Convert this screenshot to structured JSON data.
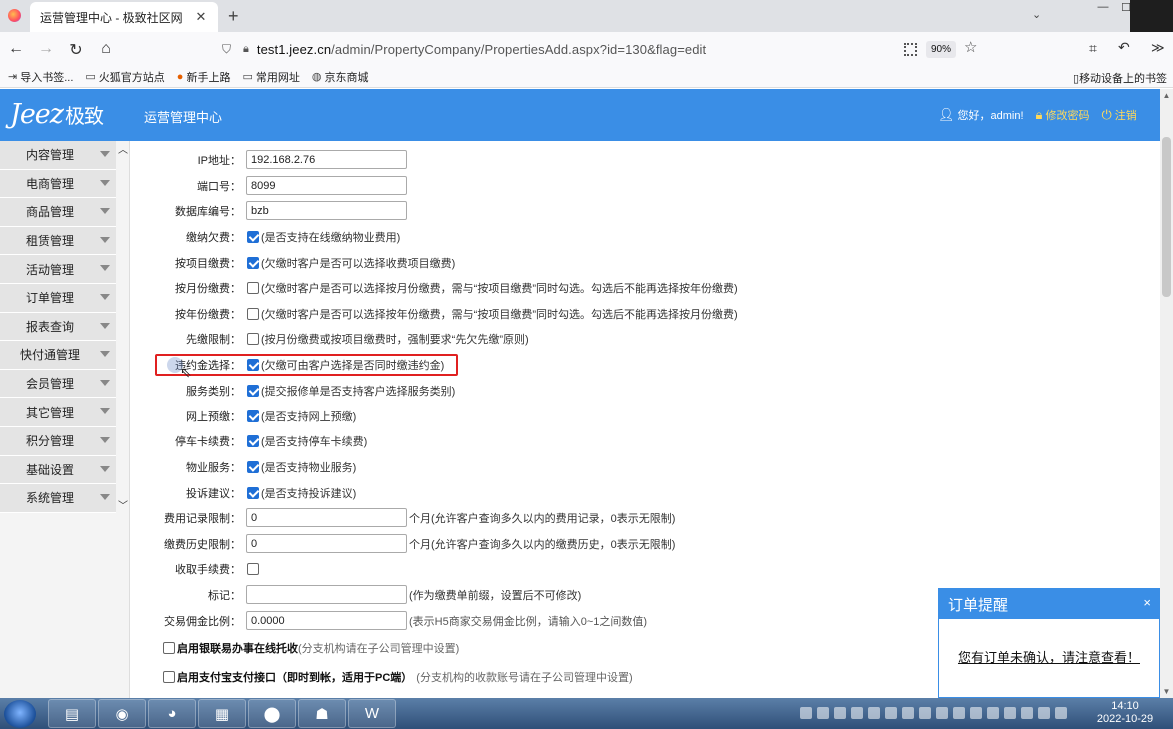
{
  "browser": {
    "tab_title": "运营管理中心 - 极致社区网",
    "url_host": "test1.jeez.cn",
    "url_path": "/admin/PropertyCompany/PropertiesAdd.aspx?id=130&flag=edit",
    "zoom": "90%",
    "bookmarks": [
      "导入书签...",
      "火狐官方站点",
      "新手上路",
      "常用网址",
      "京东商城"
    ],
    "mobile_bookmarks": "移动设备上的书签"
  },
  "header": {
    "logo_latin": "Jeez",
    "logo_cn": "极致",
    "title": "运营管理中心",
    "greeting": "您好，admin!",
    "change_password": "修改密码",
    "logout": "注销"
  },
  "sidebar": {
    "items": [
      "内容管理",
      "电商管理",
      "商品管理",
      "租赁管理",
      "活动管理",
      "订单管理",
      "报表查询",
      "快付通管理",
      "会员管理",
      "其它管理",
      "积分管理",
      "基础设置",
      "系统管理"
    ]
  },
  "form": {
    "ip_label": "IP地址：",
    "ip_value": "192.168.2.76",
    "port_label": "端口号：",
    "port_value": "8099",
    "db_label": "数据库编号：",
    "db_value": "bzb",
    "pay_arrears_label": "缴纳欠费：",
    "pay_arrears_desc": "(是否支持在线缴纳物业费用)",
    "by_item_label": "按项目缴费：",
    "by_item_desc": "(欠缴时客户是否可以选择收费项目缴费)",
    "by_month_label": "按月份缴费：",
    "by_month_desc": "(欠缴时客户是否可以选择按月份缴费，需与“按项目缴费”同时勾选。勾选后不能再选择按年份缴费)",
    "by_year_label": "按年份缴费：",
    "by_year_desc": "(欠缴时客户是否可以选择按年份缴费，需与“按项目缴费”同时勾选。勾选后不能再选择按月份缴费)",
    "first_owe_label": "先缴限制：",
    "first_owe_desc": "(按月份缴费或按项目缴费时，强制要求“先欠先缴”原则)",
    "penalty_label": "违约金选择：",
    "penalty_desc": "(欠缴可由客户选择是否同时缴违约金)",
    "service_type_label": "服务类别：",
    "service_type_desc": "(提交报修单是否支持客户选择服务类别)",
    "online_prepay_label": "网上预缴：",
    "online_prepay_desc": "(是否支持网上预缴)",
    "parking_label": "停车卡续费：",
    "parking_desc": "(是否支持停车卡续费)",
    "property_service_label": "物业服务：",
    "property_service_desc": "(是否支持物业服务)",
    "complaint_label": "投诉建议：",
    "complaint_desc": "(是否支持投诉建议)",
    "fee_record_label": "费用记录限制：",
    "fee_record_value": "0",
    "fee_record_desc": "个月(允许客户查询多久以内的费用记录，0表示无限制)",
    "pay_history_label": "缴费历史限制：",
    "pay_history_value": "0",
    "pay_history_desc": "个月(允许客户查询多久以内的缴费历史，0表示无限制)",
    "handling_fee_label": "收取手续费：",
    "mark_label": "标记：",
    "mark_value": "",
    "mark_desc": "(作为缴费单前缀，设置后不可修改)",
    "commission_label": "交易佣金比例：",
    "commission_value": "0.0000",
    "commission_desc": "(表示H5商家交易佣金比例，请输入0~1之间数值)",
    "bank_bold": "启用银联易办事在线托收",
    "bank_gray": "(分支机构请在子公司管理中设置)",
    "alipay_bold": "启用支付宝支付接口（即时到帐，适用于PC端）",
    "alipay_gray": "(分支机构的收款账号请在子公司管理中设置)"
  },
  "popup": {
    "title": "订单提醒",
    "close": "×",
    "message": "您有订单未确认，请注意查看！"
  },
  "taskbar": {
    "time": "14:10",
    "date": "2022-10-29"
  }
}
